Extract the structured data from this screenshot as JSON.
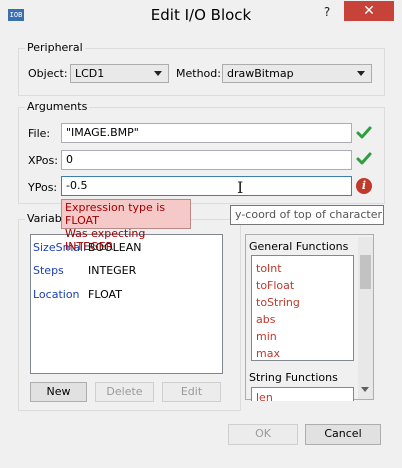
{
  "window": {
    "title": "Edit I/O Block",
    "app_icon_text": "IOB",
    "help_label": "?",
    "close_label": "✕"
  },
  "peripheral": {
    "group_label": "Peripheral",
    "object_label": "Object:",
    "object_value": "LCD1",
    "method_label": "Method:",
    "method_value": "drawBitmap"
  },
  "arguments": {
    "group_label": "Arguments",
    "file_label": "File:",
    "file_value": "\"IMAGE.BMP\"",
    "xpos_label": "XPos:",
    "xpos_value": "0",
    "ypos_label": "YPos:",
    "ypos_value": "-0.5",
    "error_line1": "Expression type is FLOAT",
    "error_line2": "Was expecting INTEGER",
    "hint": "y-coord of top of character"
  },
  "variables": {
    "group_label": "Variable",
    "items": [
      {
        "name": "SizeSmall",
        "type": "BOOLEAN"
      },
      {
        "name": "Steps",
        "type": "INTEGER"
      },
      {
        "name": "Location",
        "type": "FLOAT"
      }
    ],
    "new_label": "New",
    "delete_label": "Delete",
    "edit_label": "Edit"
  },
  "functions": {
    "general_label": "General Functions",
    "general_items": [
      "toInt",
      "toFloat",
      "toString",
      "abs",
      "min",
      "max"
    ],
    "string_label": "String Functions",
    "string_items": [
      "len"
    ]
  },
  "footer": {
    "ok_label": "OK",
    "cancel_label": "Cancel"
  },
  "colors": {
    "error": "#c0392b",
    "valid": "#2e9e3e",
    "var_name": "#1a3fb0",
    "close": "#c7433a"
  }
}
